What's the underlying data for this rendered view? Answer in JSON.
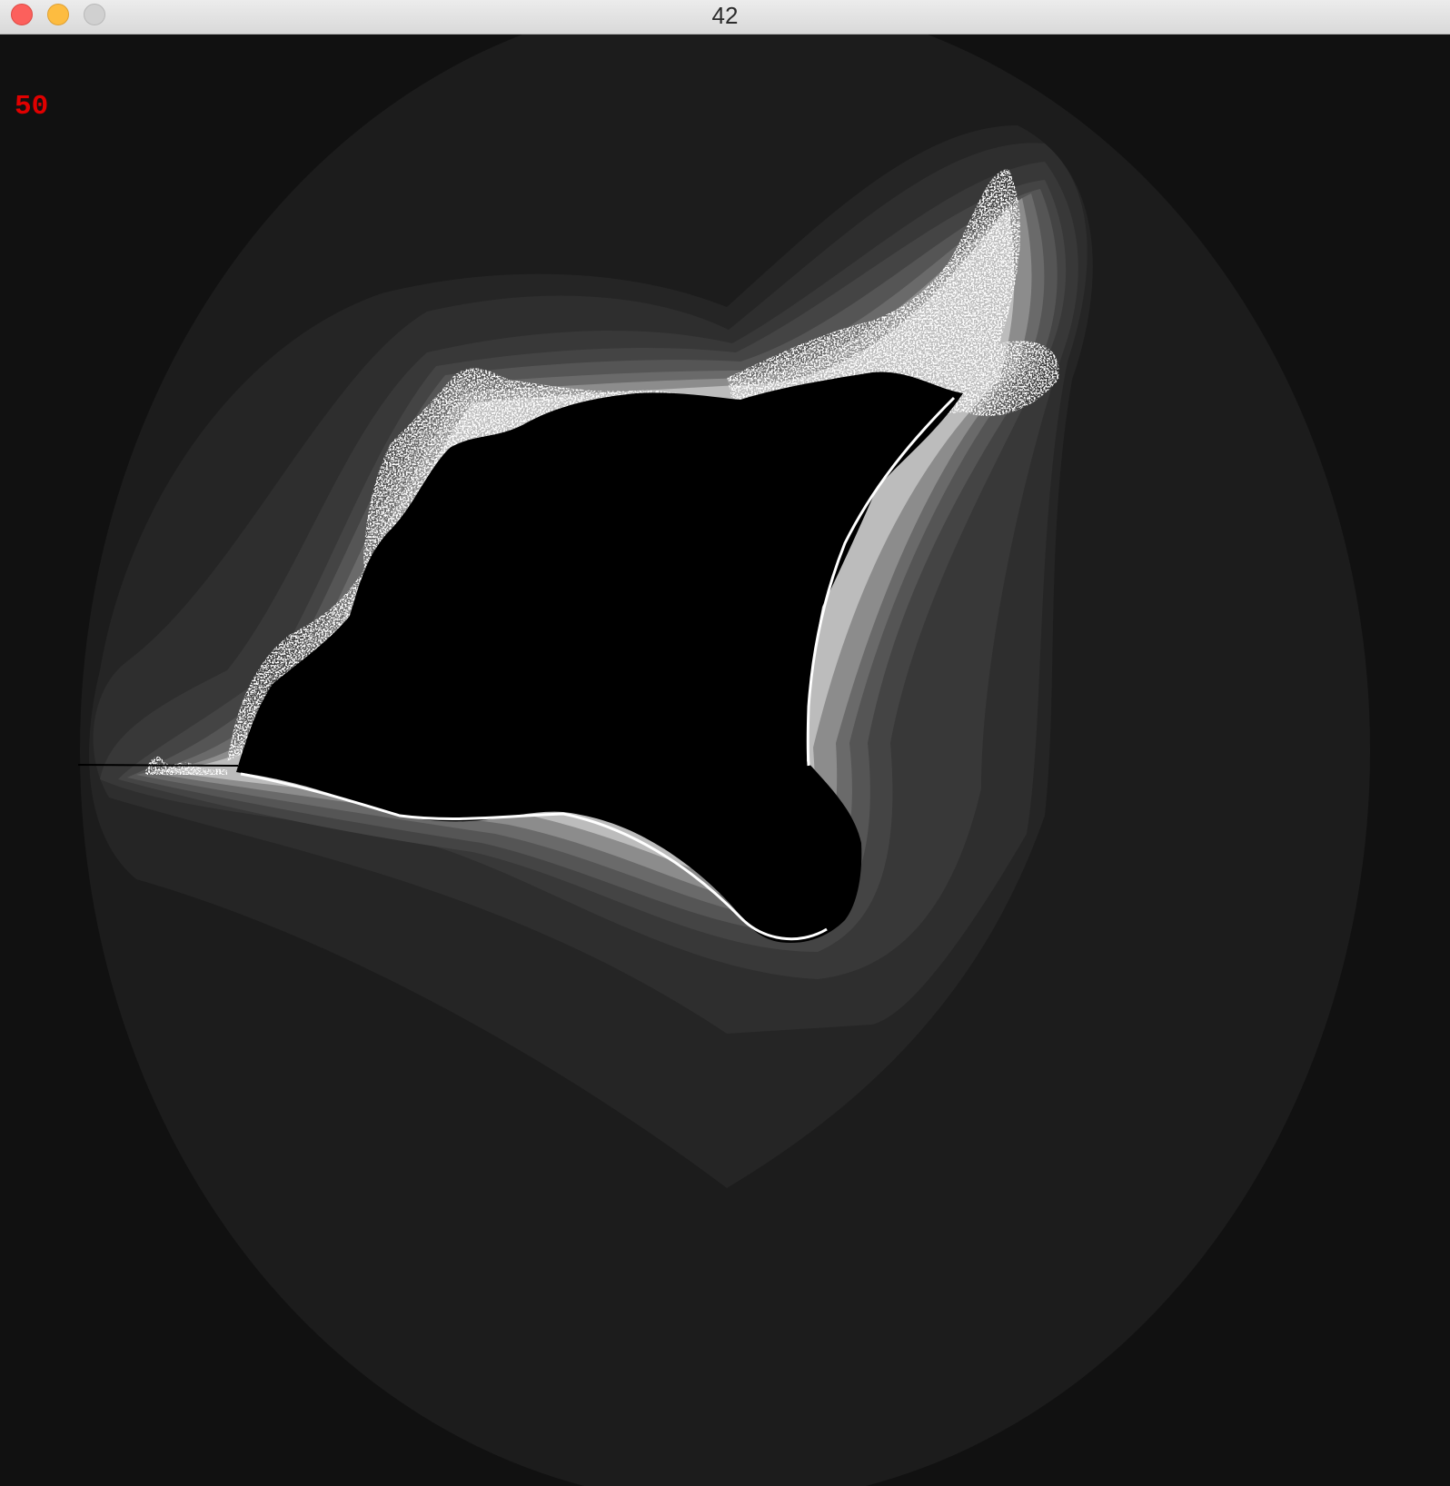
{
  "window": {
    "title": "42",
    "controls": {
      "close": "close-icon",
      "minimize": "minimize-icon",
      "zoom": "zoom-icon"
    }
  },
  "overlay": {
    "iteration_count": "50",
    "iteration_color": "#e00000"
  },
  "fractal": {
    "background_color": "#111111",
    "band_colors": [
      "#1c1c1c",
      "#252525",
      "#2e2e2e",
      "#383838",
      "#444444",
      "#555555",
      "#6a6a6a",
      "#8c8c8c",
      "#bcbcbc",
      "#ffffff"
    ],
    "interior_color": "#000000"
  }
}
